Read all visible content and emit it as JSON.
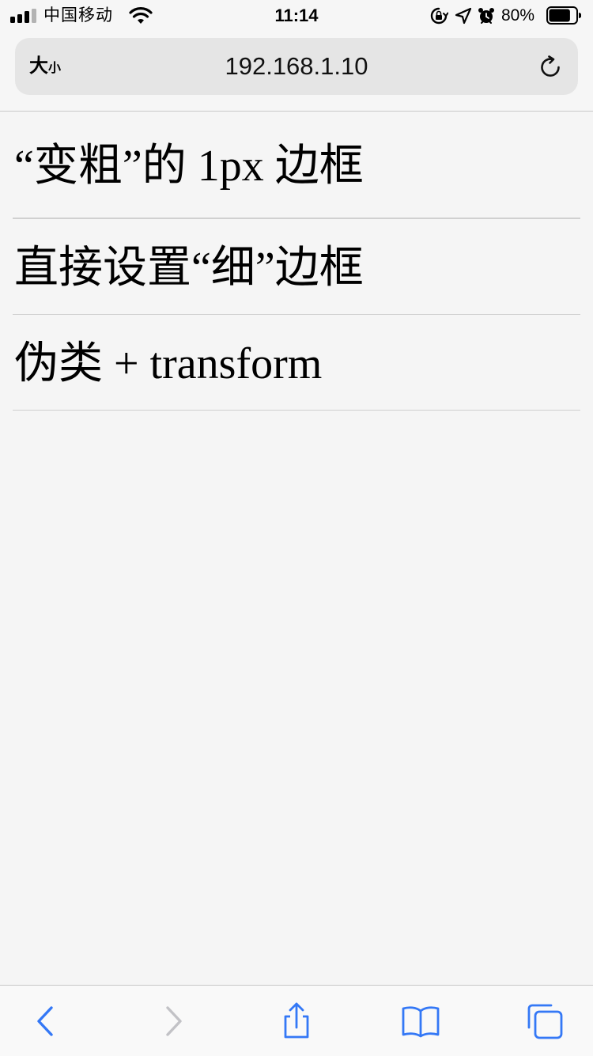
{
  "status_bar": {
    "carrier": "中国移动",
    "time": "11:14",
    "battery_percent": "80%",
    "battery_level": 0.8,
    "icons": [
      "signal-icon",
      "wifi-icon",
      "orientation-lock-icon",
      "location-icon",
      "alarm-icon",
      "battery-icon"
    ]
  },
  "browser": {
    "text_size_label": "大",
    "text_size_label_small": "小",
    "url": "192.168.1.10",
    "accent_color": "#3478f6"
  },
  "content": {
    "items": [
      {
        "label": "“变粗”的 1px 边框"
      },
      {
        "label": "直接设置“细”边框"
      },
      {
        "label": "伪类 + transform"
      }
    ]
  },
  "toolbar": {
    "buttons": [
      "back",
      "forward",
      "share",
      "bookmarks",
      "tabs"
    ]
  }
}
